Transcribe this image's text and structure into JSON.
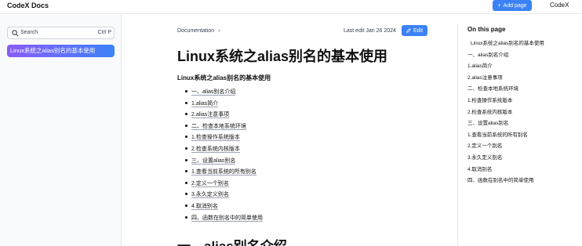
{
  "header": {
    "brand": "CodeX Docs",
    "add_page": "Add page",
    "project": "CodeX"
  },
  "sidebar": {
    "search_placeholder": "Search",
    "search_shortcut": "Ctrl P",
    "items": [
      {
        "label": "Linux系统之alias别名的基本使用",
        "active": true
      }
    ]
  },
  "main": {
    "breadcrumb": "Documentation",
    "last_edit": "Last edit Jan 26 2024",
    "edit_label": "Edit",
    "title": "Linux系统之alias别名的基本使用",
    "subtitle": "Linux系统之alias别名的基本使用",
    "toc": [
      "一、alias别名介绍",
      "1.alias简介",
      "2.alias注意事项",
      "二、检查本地系统环境",
      "1.检查操作系统版本",
      "2.检查系统内核版本",
      "三、设置alias别名",
      "1.查看当前系统的所有别名",
      "2.定义一个别名",
      "3.永久定义别名",
      "4.取消别名",
      "四、函数在别名中的简单使用"
    ],
    "section_heading": "一、alias别名介绍"
  },
  "on_this_page": {
    "title": "On this page",
    "items": [
      "Linux系统之alias别名的基本使用",
      "一、alias别名介绍",
      "1.alias简介",
      "2.alias注意事项",
      "二、检查本地系统环境",
      "1.检查操作系统版本",
      "2.检查系统内核版本",
      "三、设置alias别名",
      "1.查看当前系统的所有别名",
      "2.定义一个别名",
      "3.永久定义别名",
      "4.取消别名",
      "四、函数在别名中的简单使用"
    ]
  },
  "colors": {
    "accent": "#3b82f6",
    "active_gradient_start": "#8b5cf6",
    "active_gradient_end": "#3b82f6"
  }
}
